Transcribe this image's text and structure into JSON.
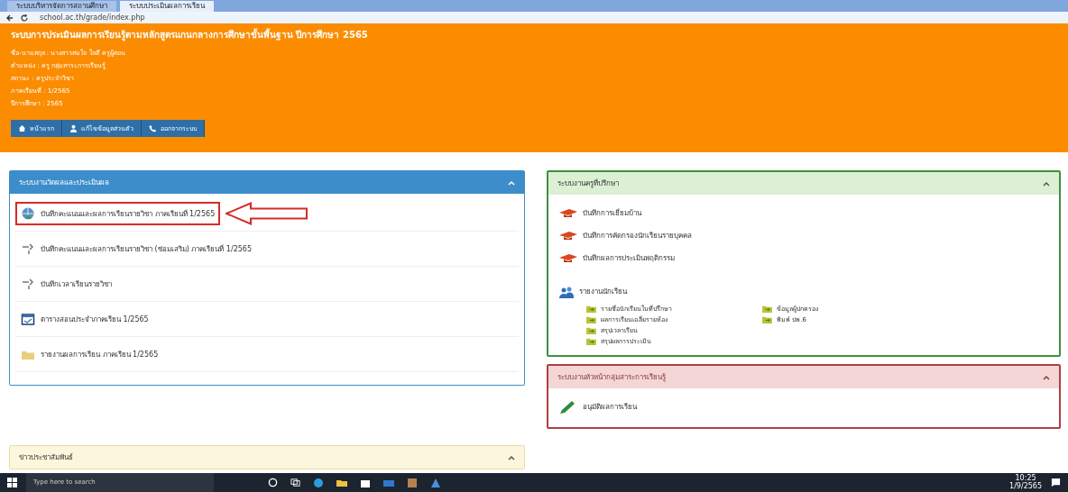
{
  "browser": {
    "tabs": [
      {
        "title": "ระบบบริหารจัดการสถานศึกษา",
        "selected": false
      },
      {
        "title": "ระบบประเมินผลการเรียน",
        "selected": true
      }
    ],
    "url": "school.ac.th/grade/index.php"
  },
  "header": {
    "title": "ระบบการประเมินผลการเรียนรู้ตามหลักสูตรแกนกลางการศึกษาขั้นพื้นฐาน ปีการศึกษา 2565",
    "info_lines": [
      "ชื่อ-นามสกุล : นางสาวสมใจ ใจดี ครูผู้สอน",
      "ตำแหน่ง : ครู กลุ่มสาระการเรียนรู้",
      "สถานะ : ครูประจำวิชา",
      "ภาคเรียนที่ : 1/2565",
      "ปีการศึกษา : 2565"
    ],
    "nav_buttons": [
      {
        "label": "หน้าแรก"
      },
      {
        "label": "แก้ไขข้อมูลส่วนตัว"
      },
      {
        "label": "ออกจากระบบ"
      }
    ]
  },
  "left_panel": {
    "title": "ระบบงานวัดผลและประเมินผล",
    "items": [
      {
        "label": "บันทึกคะแนนและผลการเรียนรายวิชา ภาคเรียนที่ 1/2565",
        "highlighted": true
      },
      {
        "label": "บันทึกคะแนนและผลการเรียนรายวิชา (ซ่อมเสริม) ภาคเรียนที่ 1/2565",
        "highlighted": false
      },
      {
        "label": "บันทึกเวลาเรียนรายวิชา",
        "highlighted": false
      },
      {
        "label": "ตารางสอนประจำภาคเรียน 1/2565",
        "highlighted": false
      },
      {
        "label": "รายงานผลการเรียน ภาคเรียน 1/2565",
        "highlighted": false
      }
    ]
  },
  "advisor_panel": {
    "title": "ระบบงานครูที่ปรึกษา",
    "links": [
      "บันทึกการเยี่ยมบ้าน",
      "บันทึกการคัดกรองนักเรียนรายบุคคล",
      "บันทึกผลการประเมินพฤติกรรม"
    ],
    "report_title": "รายงานนักเรียน",
    "report_columns": [
      [
        "รายชื่อนักเรียนในที่ปรึกษา",
        "ผลการเรียนเฉลี่ยรายห้อง",
        "สรุปเวลาเรียน",
        "สรุปผลการประเมิน"
      ],
      [
        "ข้อมูลผู้ปกครอง",
        "พิมพ์ ปพ.6"
      ]
    ]
  },
  "head_panel": {
    "title": "ระบบงานหัวหน้ากลุ่มสาระการเรียนรู้",
    "links": [
      "อนุมัติผลการเรียน"
    ]
  },
  "news_panel": {
    "title": "ข่าวประชาสัมพันธ์"
  },
  "taskbar": {
    "search_placeholder": "Type here to search",
    "time": "10:25",
    "date": "1/9/2565"
  }
}
